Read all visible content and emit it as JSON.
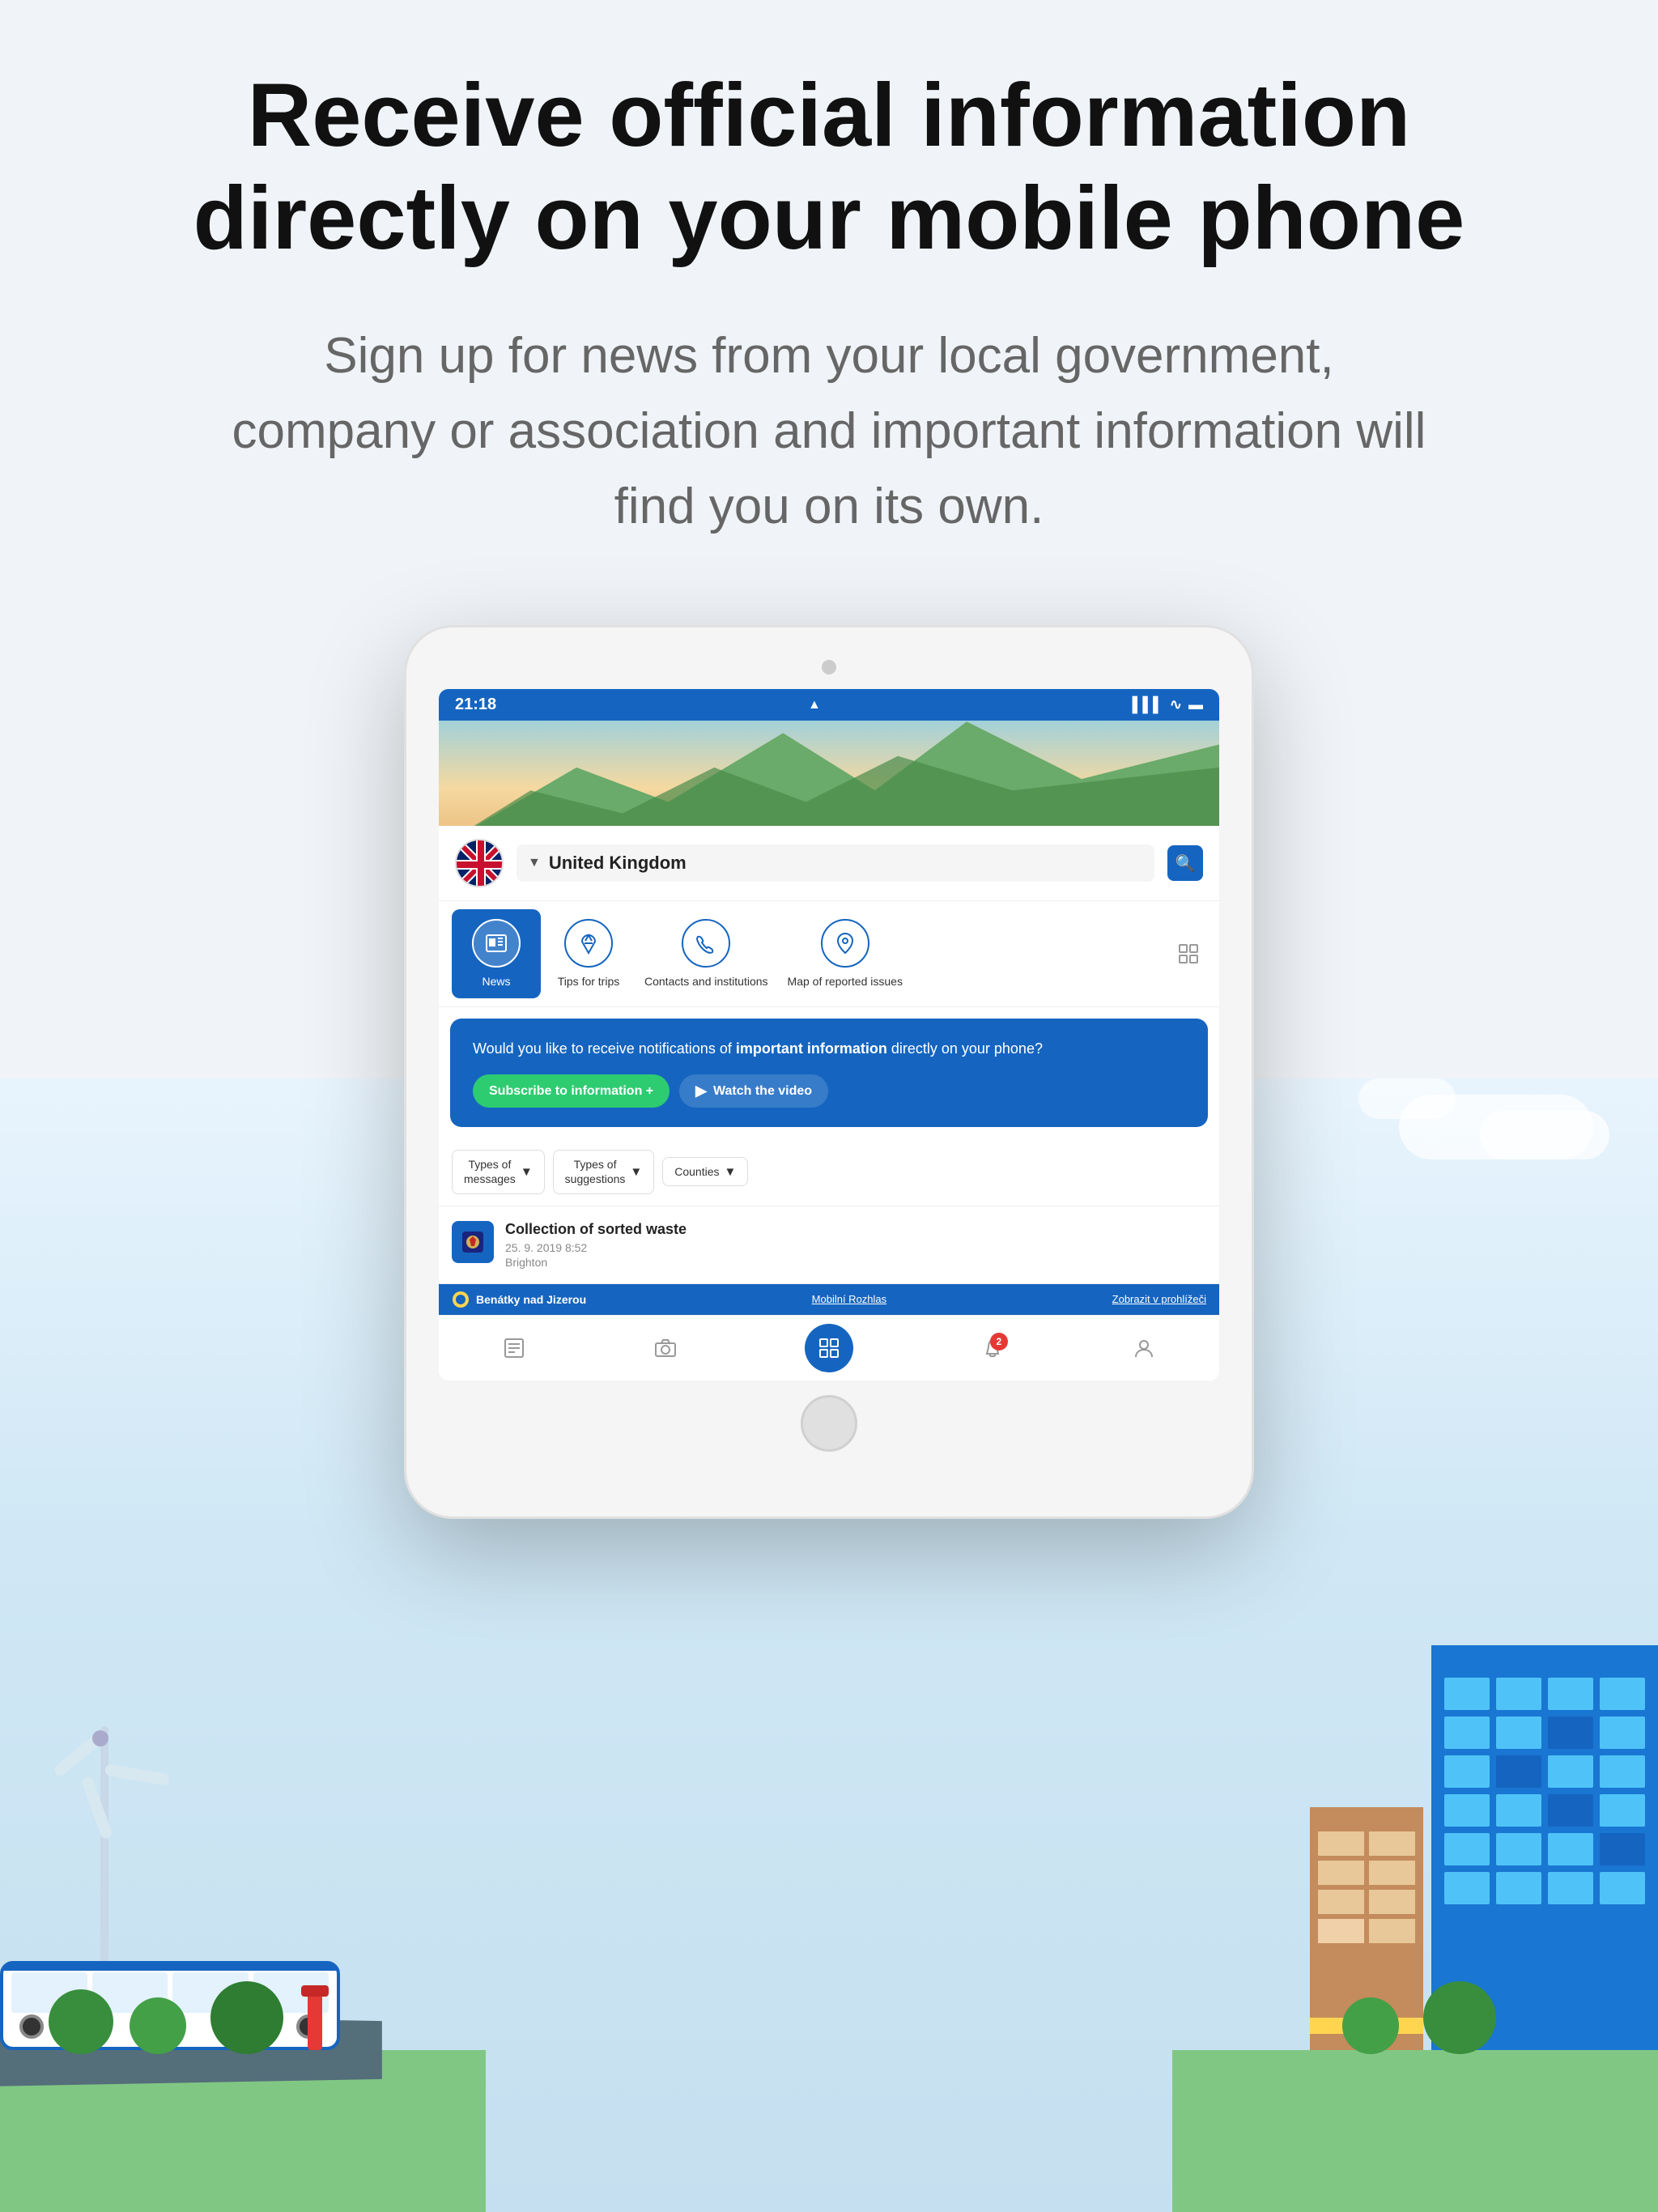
{
  "page": {
    "hero_title": "Receive official information directly on your mobile phone",
    "hero_subtitle": "Sign up for news from your local government, company or association and important information will find you on its own.",
    "tablet": {
      "status_bar": {
        "time": "21:18",
        "location_icon": "▲",
        "signal": "▌▌▌",
        "wifi": "WiFi",
        "battery": "🔋"
      },
      "location": {
        "name": "United Kingdom",
        "arrow": "▼"
      },
      "nav_items": [
        {
          "label": "News",
          "icon": "📰",
          "active": true
        },
        {
          "label": "Tips for trips",
          "icon": "✈",
          "active": false
        },
        {
          "label": "Contacts and institutions",
          "icon": "📞",
          "active": false
        },
        {
          "label": "Map of reported issues",
          "icon": "📍",
          "active": false
        }
      ],
      "info_card": {
        "text_normal": "Would you like to receive notifications of ",
        "text_bold": "important information",
        "text_end": " directly on your phone?",
        "btn_subscribe": "Subscribe to information +",
        "btn_watch": "Watch the video"
      },
      "filters": [
        {
          "label": "Types of\nmessages",
          "id": "types-messages"
        },
        {
          "label": "Types of\nsuggestions",
          "id": "types-suggestions"
        },
        {
          "label": "Counties",
          "id": "counties"
        }
      ],
      "list_items": [
        {
          "title": "Collection of sorted waste",
          "date": "25. 9. 2019 8:52",
          "location": "Brighton",
          "icon": "🗑"
        }
      ],
      "bottom_bar": {
        "logo_text": "Benátky nad Jizerou",
        "link1": "Mobilní Rozhlas",
        "link2": "Zobrazit v prohlížeči"
      },
      "app_nav": {
        "icons": [
          "≡",
          "📷",
          "⊞",
          "🔔",
          "👤"
        ],
        "active_index": 2,
        "badge_index": 3,
        "badge_count": "2"
      }
    }
  }
}
